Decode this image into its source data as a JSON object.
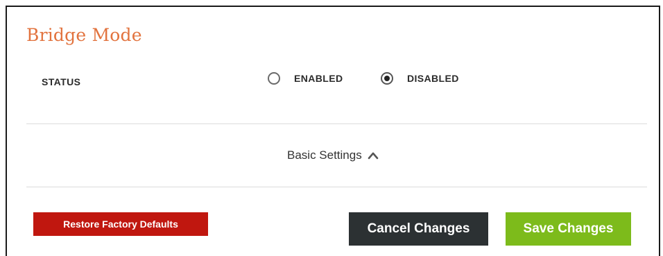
{
  "page": {
    "title": "Bridge Mode"
  },
  "status": {
    "label": "STATUS",
    "options": [
      {
        "label": "ENABLED",
        "selected": false
      },
      {
        "label": "DISABLED",
        "selected": true
      }
    ]
  },
  "basic_settings": {
    "label": "Basic Settings",
    "expanded": true,
    "icon": "chevron-up-icon"
  },
  "buttons": {
    "restore": "Restore Factory Defaults",
    "cancel": "Cancel Changes",
    "save": "Save Changes"
  },
  "colors": {
    "title": "#e2733e",
    "restore": "#c0170f",
    "cancel": "#2c3133",
    "save": "#7dbb1b"
  }
}
